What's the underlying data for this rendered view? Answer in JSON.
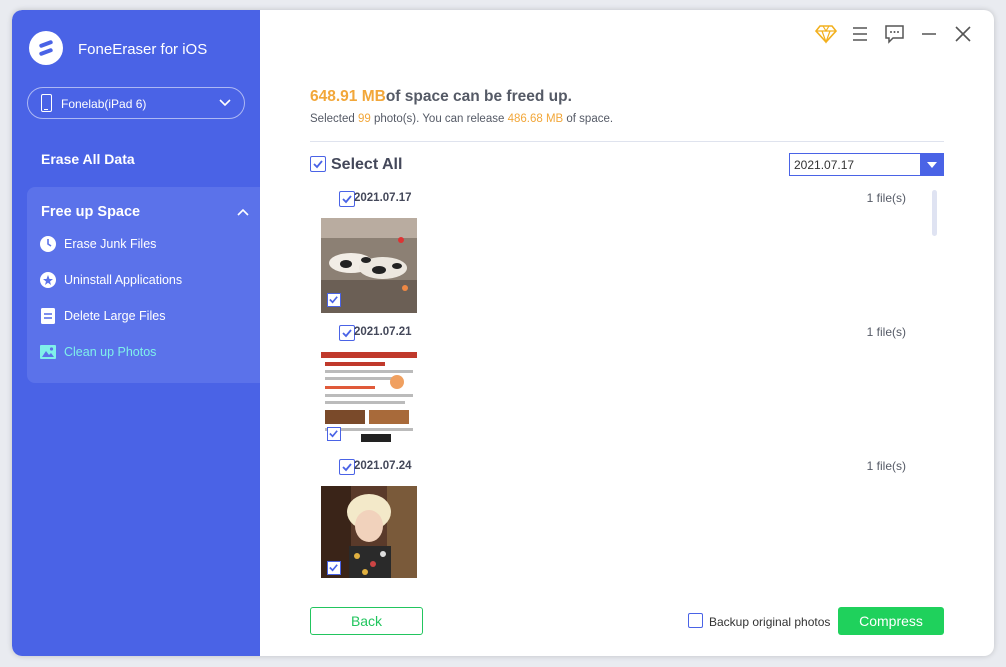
{
  "app": {
    "title": "FoneEraser for iOS"
  },
  "device": {
    "name": "Fonelab(iPad 6)"
  },
  "sidebar": {
    "erase_all": "Erase All Data",
    "free_up": {
      "title": "Free up Space",
      "items": [
        {
          "label": "Erase Junk Files",
          "icon": "clock-icon"
        },
        {
          "label": "Uninstall Applications",
          "icon": "apps-icon"
        },
        {
          "label": "Delete Large Files",
          "icon": "file-icon"
        },
        {
          "label": "Clean up Photos",
          "icon": "photo-icon",
          "active": true
        }
      ]
    }
  },
  "summary": {
    "size": "648.91 MB",
    "size_suffix": "of space can be freed up.",
    "sub_prefix": "Selected ",
    "photo_count": "99",
    "sub_middle": " photo(s). You can release ",
    "release_size": "486.68 MB",
    "sub_suffix": " of space."
  },
  "select_all": {
    "label": "Select All",
    "checked": true
  },
  "date_filter": {
    "value": "2021.07.17"
  },
  "groups": [
    {
      "date": "2021.07.17",
      "count": "1 file(s)",
      "checked": true
    },
    {
      "date": "2021.07.21",
      "count": "1 file(s)",
      "checked": true
    },
    {
      "date": "2021.07.24",
      "count": "1 file(s)",
      "checked": true
    }
  ],
  "footer": {
    "back": "Back",
    "backup_label": "Backup original photos",
    "backup_checked": false,
    "compress": "Compress"
  },
  "colors": {
    "sidebar": "#4a63e6",
    "accent_orange": "#f2a73a",
    "active_item": "#7ff0ea",
    "green": "#1fd15c"
  }
}
